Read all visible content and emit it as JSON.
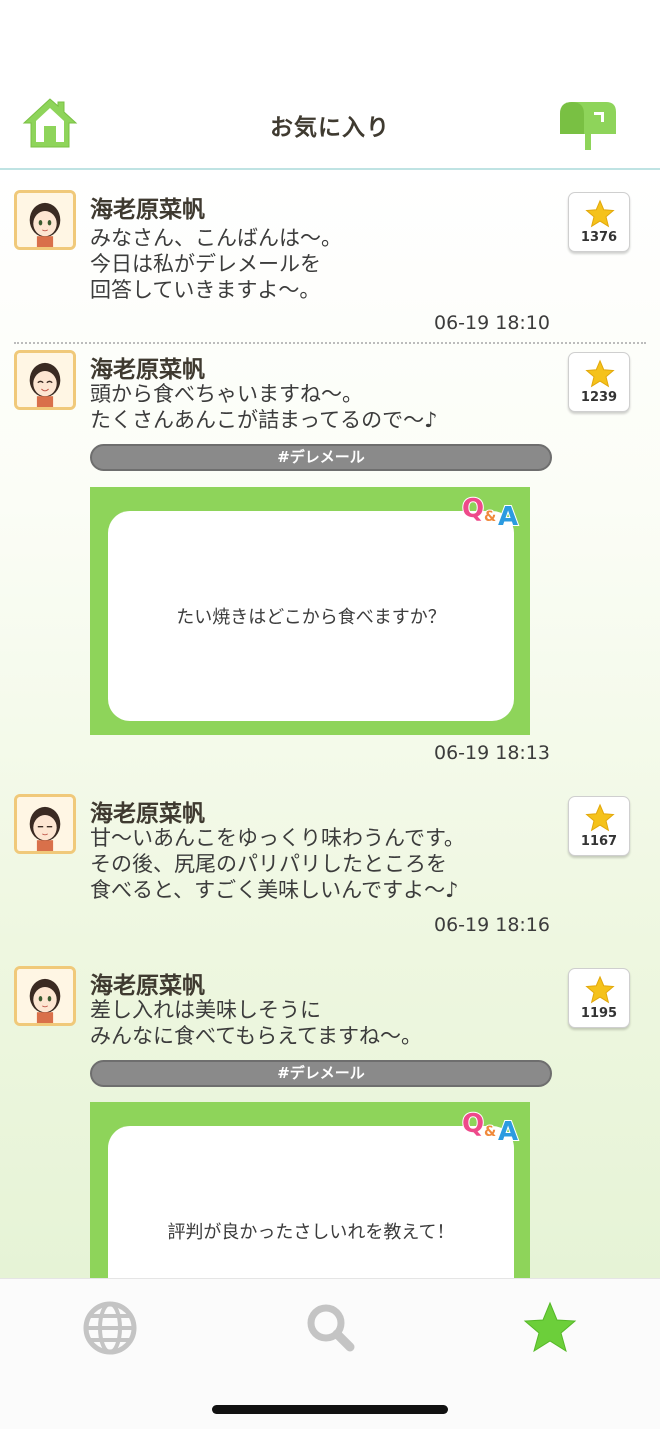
{
  "header": {
    "title": "お気に入り",
    "home_icon": "home-icon",
    "mail_icon": "mailbox-icon"
  },
  "colors": {
    "accent_green": "#8ed45a",
    "star_yellow": "#f5c21b",
    "tag_gray": "#8a8a8a"
  },
  "posts": [
    {
      "name": "海老原菜帆",
      "text": "みなさん、こんばんは〜。\n今日は私がデレメールを\n回答していきますよ〜。",
      "time": "06-19 18:10",
      "favorites": "1376"
    },
    {
      "name": "海老原菜帆",
      "text": "頭から食べちゃいますね〜。\nたくさんあんこが詰まってるので〜♪",
      "tag": "#デレメール",
      "question": "たい焼きはどこから食べますか？",
      "time": "06-19 18:13",
      "favorites": "1239"
    },
    {
      "name": "海老原菜帆",
      "text": "甘〜いあんこをゆっくり味わうんです。\nその後、尻尾のパリパリしたところを\n食べると、すごく美味しいんですよ〜♪",
      "time": "06-19 18:16",
      "favorites": "1167"
    },
    {
      "name": "海老原菜帆",
      "text": "差し入れは美味しそうに\nみんなに食べてもらえてますね〜。",
      "tag": "#デレメール",
      "question": "評判が良かったさしいれを教えて！",
      "favorites": "1195"
    }
  ],
  "qa_badge": {
    "q": "Q",
    "amp": "&",
    "a": "A"
  },
  "nav": {
    "items": [
      {
        "icon": "globe-icon",
        "active": false
      },
      {
        "icon": "search-icon",
        "active": false
      },
      {
        "icon": "star-icon",
        "active": true
      }
    ]
  }
}
